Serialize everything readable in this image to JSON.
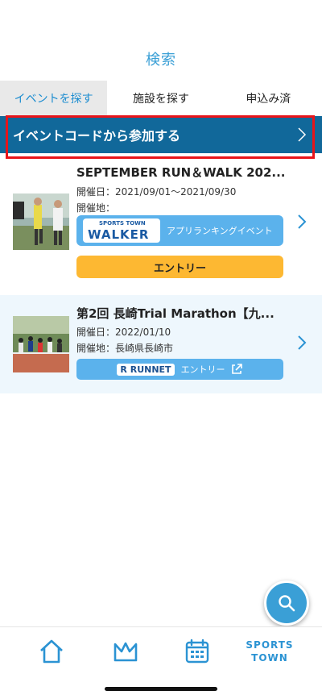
{
  "header": {
    "title": "検索"
  },
  "tabs": [
    {
      "label": "イベントを探す",
      "active": true
    },
    {
      "label": "施設を探す",
      "active": false
    },
    {
      "label": "申込み済",
      "active": false
    }
  ],
  "code_bar": {
    "label": "イベントコードから参加する"
  },
  "events": [
    {
      "title": "SEPTEMBER RUN＆WALK 202...",
      "date_line": "開催日：2021/09/01～2021/09/30",
      "venue_line": "開催地：",
      "walker_logo_top": "SPORTS TOWN",
      "walker_logo_main": "WALKER",
      "walker_button_text": "アプリランキングイベント",
      "entry_label": "エントリー"
    },
    {
      "title": "第2回 長崎Trial Marathon【九...",
      "date_line": "開催日：2022/01/10",
      "venue_line": "開催地：長崎県長崎市",
      "runnet_logo": "R RUNNET",
      "runnet_entry_label": "エントリー"
    }
  ],
  "bottom_nav": {
    "sports_line1": "SPORTS",
    "sports_line2": "TOWN"
  },
  "colors": {
    "accent": "#3a9fd6",
    "code_bar": "#11689a",
    "highlight": "#e8141a",
    "entry": "#fdb832"
  }
}
